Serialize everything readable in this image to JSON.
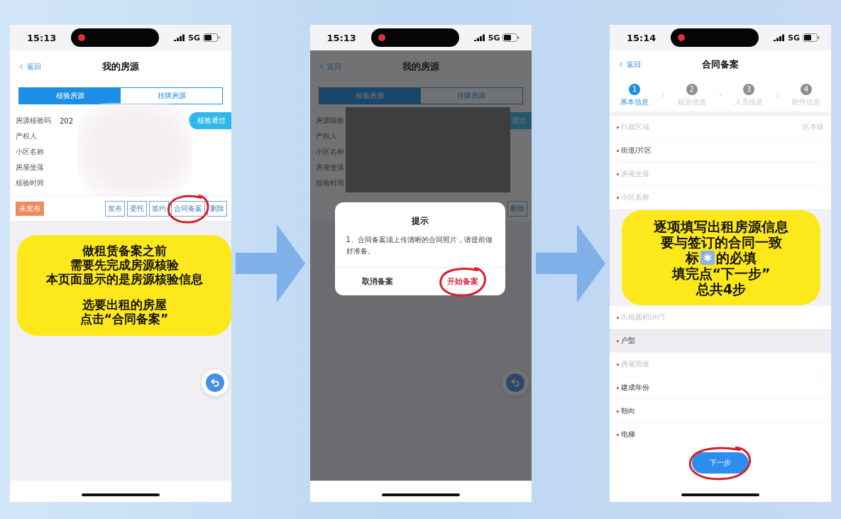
{
  "screens": [
    {
      "kind": "listing",
      "dimmed": false,
      "status_bar": {
        "time": "15:13",
        "network": "5G"
      },
      "header": {
        "back": "返回",
        "title": "我的房源"
      },
      "tabs": [
        {
          "label": "核验房源",
          "selected": true
        },
        {
          "label": "挂牌房源",
          "selected": false
        }
      ],
      "record": {
        "status": "核验通过",
        "fields": [
          {
            "label": "房源核验码",
            "value": "202"
          },
          {
            "label": "产权人"
          },
          {
            "label": "小区名称"
          },
          {
            "label": "房屋坐落"
          },
          {
            "label": "核验时间"
          }
        ],
        "badge": "未发布",
        "actions": [
          {
            "label": "发布",
            "circled": false
          },
          {
            "label": "委托",
            "circled": false
          },
          {
            "label": "签约",
            "circled": false
          },
          {
            "label": "合同备案",
            "circled": true
          },
          {
            "label": "删除",
            "circled": false
          }
        ]
      },
      "callout": {
        "paragraphs": [
          [
            "做租赁备案之前",
            "需要先完成房源核验",
            "本页面显示的是房源核验信息"
          ],
          [
            "选要出租的房屋",
            "点击“合同备案”"
          ]
        ]
      }
    },
    {
      "kind": "listing",
      "dimmed": true,
      "status_bar": {
        "time": "15:13",
        "network": "5G"
      },
      "header": {
        "back": "返回",
        "title": "我的房源"
      },
      "tabs": [
        {
          "label": "核验房源",
          "selected": true
        },
        {
          "label": "挂牌房源",
          "selected": false
        }
      ],
      "record": {
        "status": "通过",
        "fields": [
          {
            "label": "房源核验"
          },
          {
            "label": "产权人"
          },
          {
            "label": "小区名称"
          },
          {
            "label": "房屋坐落"
          },
          {
            "label": "核验时间"
          }
        ],
        "actions": [
          {
            "label": "删除",
            "circled": false
          }
        ]
      },
      "dialog": {
        "title": "提示",
        "message": "1、合同备案须上传清晰的合同照片，请提前做好准备。",
        "buttons": [
          {
            "label": "取消备案",
            "kind": "cancel",
            "circled": false
          },
          {
            "label": "开始备案",
            "kind": "confirm",
            "circled": true
          }
        ]
      }
    },
    {
      "kind": "form",
      "status_bar": {
        "time": "15:14",
        "network": "5G"
      },
      "header": {
        "back": "返回",
        "title": "合同备案"
      },
      "steps": [
        {
          "number": "1",
          "label": "基本信息",
          "selected": true
        },
        {
          "number": "2",
          "label": "租赁信息",
          "selected": false
        },
        {
          "number": "3",
          "label": "人员信息",
          "selected": false
        },
        {
          "number": "4",
          "label": "附件信息",
          "selected": false
        }
      ],
      "fields_before": [
        {
          "label": "行政区域",
          "value": "区本级",
          "required": true,
          "disabled": true,
          "highlighted": false
        },
        {
          "label": "街道/片区",
          "required": true,
          "disabled": false,
          "highlighted": false
        },
        {
          "label": "房屋坐落",
          "required": true,
          "disabled": true,
          "highlighted": false
        },
        {
          "label": "小区名称",
          "required": true,
          "disabled": true,
          "highlighted": false
        }
      ],
      "callout": {
        "lines": [
          "逐项填写出租房源信息",
          "要与签订的合同一致",
          {
            "before": "标",
            "mark": "✱",
            "after": "的必填"
          },
          "填完点“下一步”",
          "总共4步"
        ]
      },
      "fields_after": [
        {
          "label": "出租面积(m²)",
          "required": true,
          "disabled": true,
          "highlighted": false
        },
        {
          "label": "户型",
          "required": true,
          "disabled": false,
          "highlighted": true
        },
        {
          "label": "房屋用途",
          "required": true,
          "disabled": true,
          "highlighted": false
        },
        {
          "label": "建成年份",
          "required": true,
          "disabled": false,
          "highlighted": false
        },
        {
          "label": "朝向",
          "required": true,
          "disabled": false,
          "highlighted": false
        },
        {
          "label": "电梯",
          "required": true,
          "disabled": false,
          "highlighted": false
        }
      ],
      "next_button": {
        "label": "下一步",
        "circled": true
      }
    }
  ]
}
